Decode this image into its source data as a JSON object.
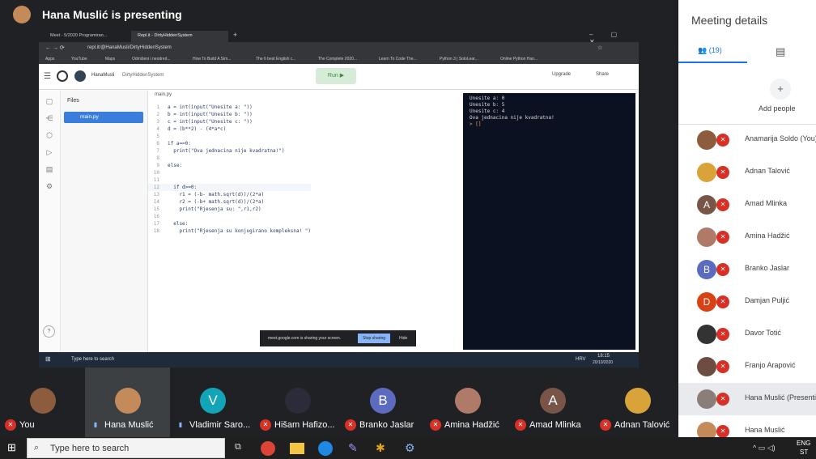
{
  "header": {
    "presenting": "Hana Muslić is presenting"
  },
  "browser": {
    "tabs": [
      "Meet - 5/2020 Programiran...",
      "Repl.it - DirtyHiddenSystem"
    ],
    "new_tab": "+",
    "url": "repl.it/@HanaMusli/DirtyHiddenSystem",
    "bookmarks": [
      "Apps",
      "YouTube",
      "Maps",
      "Odmišeni i neodred...",
      "How To Build A Sim...",
      "The 6 best English c...",
      "The Complete 2020...",
      "Learn To Code The...",
      "Python 3 | SoloLear...",
      "Online Python Han..."
    ]
  },
  "repl": {
    "user": "HanaMusli",
    "project": "DirtyHiddenSystem",
    "run": "Run ▶",
    "upgrade": "Upgrade",
    "share": "Share",
    "files_title": "Files",
    "file": "main.py",
    "editor_tab": "main.py",
    "help": "?",
    "code": [
      {
        "n": "1",
        "t": "a = int(input(\"Unesite a: \"))"
      },
      {
        "n": "2",
        "t": "b = int(input(\"Unesite b: \"))"
      },
      {
        "n": "3",
        "t": "c = int(input(\"Unesite c: \"))"
      },
      {
        "n": "4",
        "t": "d = (b**2) - (4*a*c)"
      },
      {
        "n": "5",
        "t": ""
      },
      {
        "n": "6",
        "t": "if a==0:"
      },
      {
        "n": "7",
        "t": "  print(\"Ova jednacina nije kvadratna!\")"
      },
      {
        "n": "8",
        "t": ""
      },
      {
        "n": "9",
        "t": "else:"
      },
      {
        "n": "10",
        "t": ""
      },
      {
        "n": "11",
        "t": ""
      },
      {
        "n": "12",
        "t": "  if d>=0:"
      },
      {
        "n": "13",
        "t": "    r1 = (-b- math.sqrt(d))/(2*a)"
      },
      {
        "n": "14",
        "t": "    r2 = (-b+ math.sqrt(d))/(2*a)"
      },
      {
        "n": "15",
        "t": "    print(\"Rjesenja su: \",r1,r2)"
      },
      {
        "n": "16",
        "t": ""
      },
      {
        "n": "17",
        "t": "  else:"
      },
      {
        "n": "18",
        "t": "    print(\"Rjesenja su konjugirano kompleksna! \")"
      }
    ],
    "console": [
      "Unesite a: 0",
      "Unesite b: 5",
      "Unesite c: 4",
      "Ova jednacina nije kvadratna!",
      "> []"
    ]
  },
  "share_banner": {
    "text": "meet.google.com is sharing your screen.",
    "stop": "Stop sharing",
    "hide": "Hide"
  },
  "inner_taskbar": {
    "search": "Type here to search",
    "time": "18:15",
    "date": "20/10/2020",
    "lang": "HRV"
  },
  "tiles": [
    {
      "name": "You",
      "initial": "",
      "color": "#8d5b3e",
      "muted": true
    },
    {
      "name": "Hana Muslić",
      "initial": "",
      "color": "#c58a5a",
      "muted": false
    },
    {
      "name": "Vladimir Saro...",
      "initial": "V",
      "color": "#12a5b8",
      "muted": false
    },
    {
      "name": "Hišam Hafizo...",
      "initial": "",
      "color": "#2b2b3a",
      "muted": true
    },
    {
      "name": "Branko Jaslar",
      "initial": "B",
      "color": "#5c6bc0",
      "muted": true
    },
    {
      "name": "Amina Hadžić",
      "initial": "",
      "color": "#b07a68",
      "muted": true
    },
    {
      "name": "Amad Mlinka",
      "initial": "A",
      "color": "#795548",
      "muted": true
    },
    {
      "name": "Adnan Talović",
      "initial": "",
      "color": "#d9a33a",
      "muted": true
    }
  ],
  "panel": {
    "title": "Meeting details",
    "people_count": "(19)",
    "add_people": "Add people",
    "participants": [
      {
        "name": "Anamarija Soldo (You)",
        "initial": "",
        "color": "#8d5b3e"
      },
      {
        "name": "Adnan Talović",
        "initial": "",
        "color": "#d9a33a"
      },
      {
        "name": "Amad Mlinka",
        "initial": "A",
        "color": "#795548"
      },
      {
        "name": "Amina Hadžić",
        "initial": "",
        "color": "#b07a68"
      },
      {
        "name": "Branko Jaslar",
        "initial": "B",
        "color": "#5c6bc0"
      },
      {
        "name": "Damjan Puljić",
        "initial": "D",
        "color": "#d84315"
      },
      {
        "name": "Davor Totić",
        "initial": "",
        "color": "#333"
      },
      {
        "name": "Franjo Arapović",
        "initial": "",
        "color": "#6d4c41"
      },
      {
        "name": "Hana Muslić (Presenting)",
        "initial": "",
        "color": "#8a7f78"
      },
      {
        "name": "Hana Muslić",
        "initial": "",
        "color": "#c58a5a"
      }
    ]
  },
  "taskbar": {
    "search": "Type here to search",
    "lang": "ENG",
    "region": "ST"
  }
}
